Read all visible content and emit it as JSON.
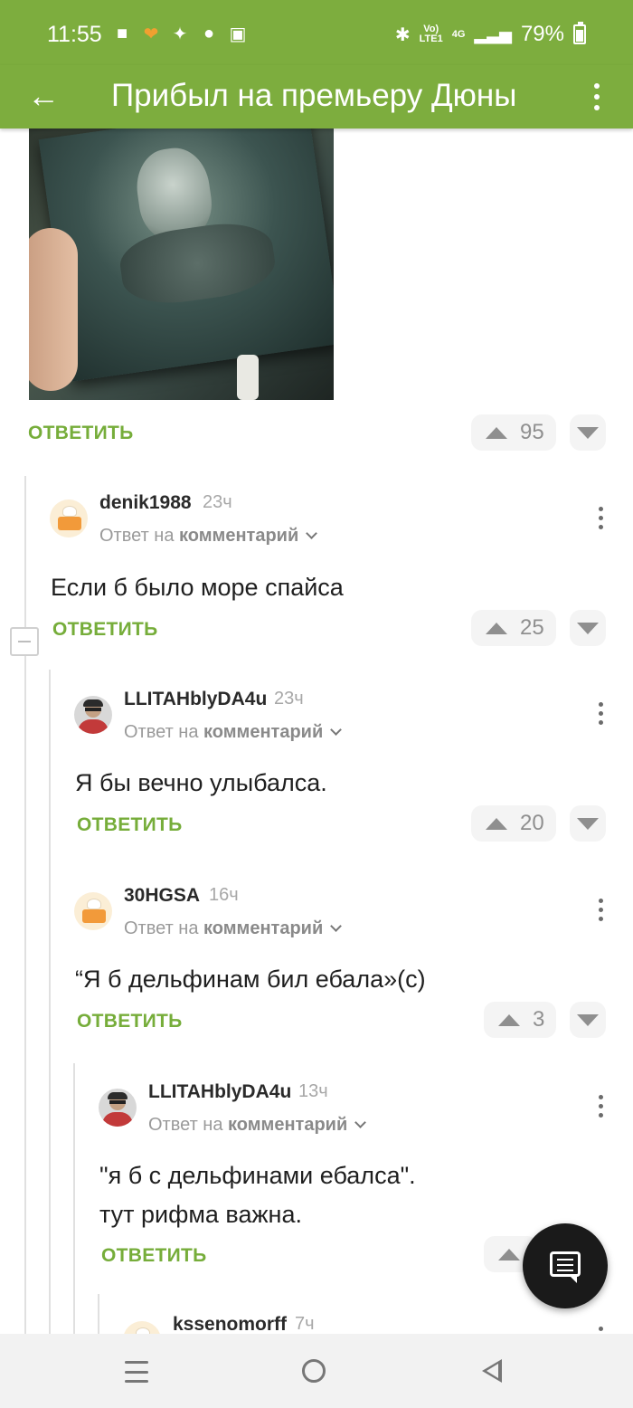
{
  "status_bar": {
    "time": "11:55",
    "network_label_top": "Vo)",
    "network_label_bottom": "LTE1",
    "network_type": "4G",
    "battery": "79%"
  },
  "toolbar": {
    "title": "Прибыл на премьеру Дюны"
  },
  "post": {
    "reply_label": "ОТВЕТИТЬ",
    "votes": "95"
  },
  "comments": [
    {
      "username": "denik1988",
      "time": "23ч",
      "reply_prefix": "Ответ на",
      "reply_target": "комментарий",
      "text": "Если б было море спайса",
      "reply_label": "ОТВЕТИТЬ",
      "votes": "25"
    },
    {
      "username": "LLITAHblyDA4u",
      "time": "23ч",
      "reply_prefix": "Ответ на",
      "reply_target": "комментарий",
      "text": "Я бы вечно улыбалса.",
      "reply_label": "ОТВЕТИТЬ",
      "votes": "20"
    },
    {
      "username": "30HGSA",
      "time": "16ч",
      "reply_prefix": "Ответ на",
      "reply_target": "комментарий",
      "text": "“Я б дельфинам бил ебала»(с)",
      "reply_label": "ОТВЕТИТЬ",
      "votes": "3"
    },
    {
      "username": "LLITAHblyDA4u",
      "time": "13ч",
      "reply_prefix": "Ответ на",
      "reply_target": "комментарий",
      "text_line1": "\"я б с дельфинами ебалса\".",
      "text_line2": "тут рифма важна.",
      "reply_label": "ОТВЕТИТЬ"
    },
    {
      "username": "kssenomorff",
      "time": "7ч"
    }
  ],
  "colors": {
    "brand_green": "#7dad3e",
    "reply_green": "#76ad3a"
  },
  "icons": {
    "fab": "chat-bubble-icon",
    "back": "arrow-left-icon",
    "menu": "more-vertical-icon"
  }
}
